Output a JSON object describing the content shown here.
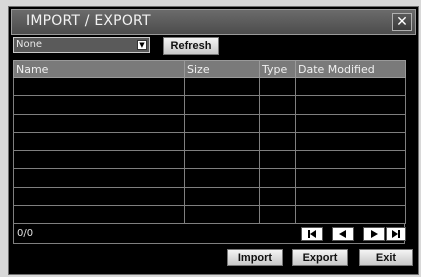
{
  "dialog": {
    "title": "IMPORT / EXPORT",
    "close_glyph": "✕"
  },
  "toolbar": {
    "selected_option": "None",
    "refresh_label": "Refresh"
  },
  "table": {
    "columns": [
      "Name",
      "Size",
      "Type",
      "Date Modified"
    ],
    "rows": [
      [
        "",
        "",
        "",
        ""
      ],
      [
        "",
        "",
        "",
        ""
      ],
      [
        "",
        "",
        "",
        ""
      ],
      [
        "",
        "",
        "",
        ""
      ],
      [
        "",
        "",
        "",
        ""
      ],
      [
        "",
        "",
        "",
        ""
      ],
      [
        "",
        "",
        "",
        ""
      ],
      [
        "",
        "",
        "",
        ""
      ]
    ]
  },
  "pagination": {
    "count_text": "0/0",
    "buttons": [
      "first-page-icon",
      "previous-page-icon",
      "next-page-icon",
      "last-page-icon"
    ]
  },
  "actions": {
    "import_label": "Import",
    "export_label": "Export",
    "exit_label": "Exit"
  },
  "colors": {
    "background": "#000000",
    "titlebar": "#5a5a5a",
    "header": "#7a7a7a",
    "grid": "#7f7f7f",
    "button": "#dcdcdc"
  }
}
